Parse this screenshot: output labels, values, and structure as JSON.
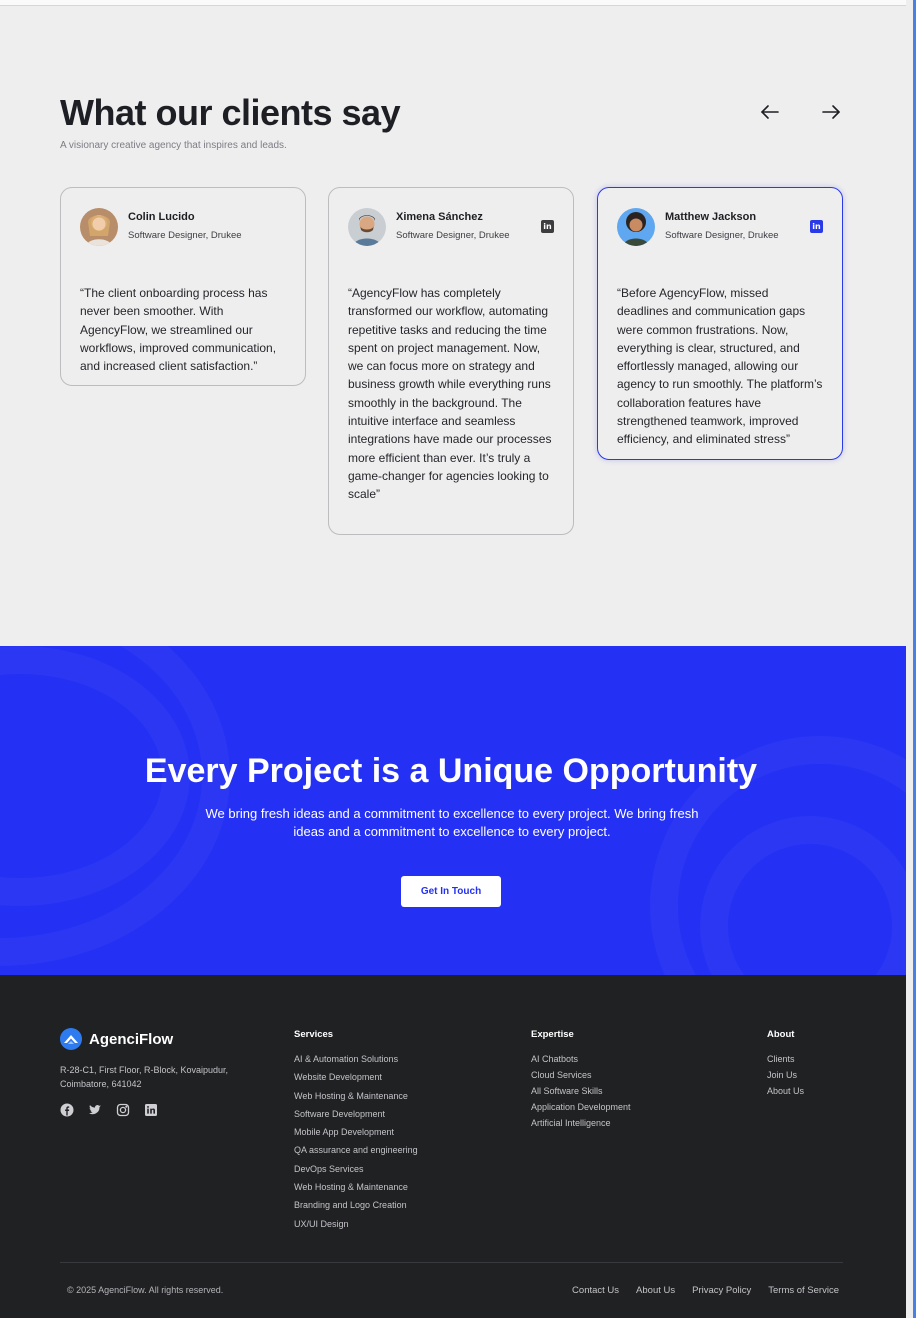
{
  "testimonials": {
    "title": "What our clients say",
    "subtitle": "A visionary creative agency that inspires and leads.",
    "cards": [
      {
        "name": "Colin Lucido",
        "role": "Software Designer, Drukee",
        "linkedin": false,
        "active": false,
        "quote": "“The client onboarding process has never been smoother. With AgencyFlow, we streamlined our workflows, improved communication, and increased client satisfaction.”"
      },
      {
        "name": "Ximena Sánchez",
        "role": "Software Designer, Drukee",
        "linkedin": true,
        "active": false,
        "quote": "“AgencyFlow has completely transformed our workflow, automating repetitive tasks and reducing the time spent on project management. Now, we can focus more on strategy and business growth while everything runs smoothly in the background. The intuitive interface and seamless integrations have made our processes more efficient than ever. It’s truly a game-changer for agencies looking to scale”"
      },
      {
        "name": "Matthew Jackson",
        "role": "Software Designer, Drukee",
        "linkedin": true,
        "active": true,
        "quote": "“Before AgencyFlow, missed deadlines and communication gaps were common frustrations. Now, everything is clear, structured, and effortlessly managed, allowing our agency to run smoothly. The platform’s collaboration features have strengthened teamwork, improved efficiency, and eliminated stress”"
      }
    ]
  },
  "icons": {
    "prev": "arrow-left-icon",
    "next": "arrow-right-icon",
    "linkedin_glyph": "in"
  },
  "cta": {
    "title": "Every Project is a Unique Opportunity",
    "text": "We bring fresh ideas and a commitment to excellence to every project. We bring fresh ideas and a commitment to excellence to every project.",
    "button": "Get In Touch"
  },
  "footer": {
    "brand": "AgenciFlow",
    "address": "R-28-C1, First Floor, R-Block, Kovaipudur, Coimbatore, 641042",
    "services_title": "Services",
    "services": [
      "AI & Automation Solutions",
      "Website Development",
      "Web Hosting & Maintenance",
      "Software Development",
      "Mobile App Development",
      "QA assurance and engineering",
      "DevOps Services",
      "Web Hosting & Maintenance",
      "Branding and Logo Creation",
      "UX/UI Design"
    ],
    "expertise_title": "Expertise",
    "expertise": [
      "AI Chatbots",
      "Cloud Services",
      "All Software Skills",
      "Application Development",
      "Artificial Intelligence"
    ],
    "about_title": "About",
    "about": [
      "Clients",
      "Join Us",
      "About Us"
    ],
    "copyright": "© 2025 AgenciFlow. All rights reserved.",
    "bottom_links": [
      "Contact Us",
      "About Us",
      "Privacy Policy",
      "Terms of Service"
    ]
  },
  "colors": {
    "accent": "#2430f3",
    "footer_bg": "#202123",
    "page_bg": "#efeeee",
    "active_border": "#2a3ae8"
  }
}
